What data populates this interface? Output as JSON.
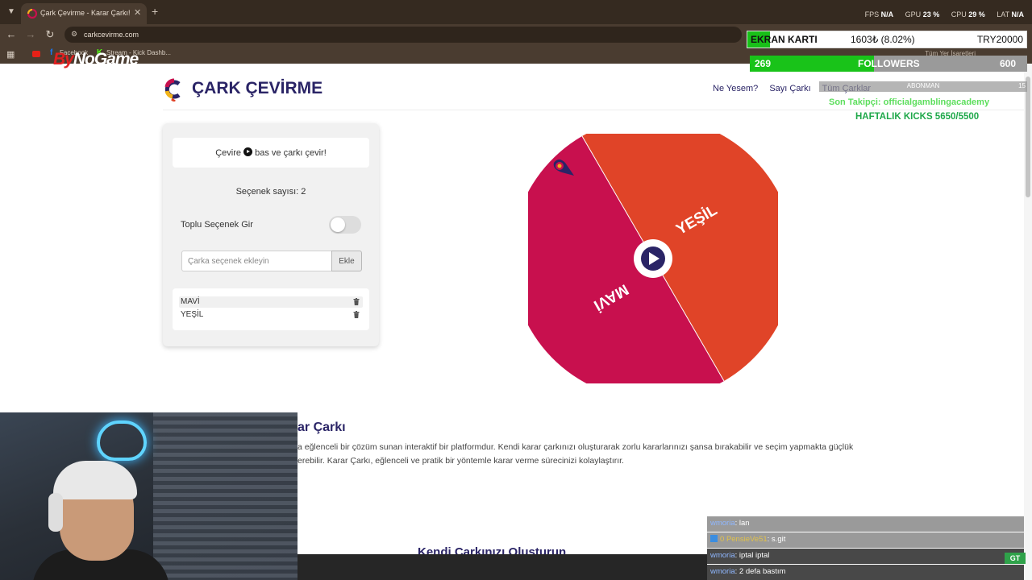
{
  "browser": {
    "tab_title": "Çark Çevirme - Karar Çarkı!",
    "url": "carkcevirme.com",
    "bookmarks": [
      "Facebook",
      "Stream - Kick Dashb..."
    ],
    "all_bookmarks": "Tüm Yer İşaretleri",
    "perf": {
      "fps_label": "FPS",
      "fps": "N/A",
      "gpu_label": "GPU",
      "gpu": "23 %",
      "cpu_label": "CPU",
      "cpu": "29 %",
      "lat_label": "LAT",
      "lat": "N/A"
    }
  },
  "overlay": {
    "brand": {
      "part1": "By",
      "part2": "NoGame"
    },
    "gpu": {
      "label": "EKRAN KARTI",
      "price": "1603₺ (8.02%)",
      "target": "TRY20000",
      "progress_percent": 8.02
    },
    "followers": {
      "count": "269",
      "label": "FOLLOWERS",
      "goal": "600",
      "progress_fraction": 0.448
    },
    "subs": {
      "label": "ABONMAN",
      "count": "15"
    },
    "last_follower": "Son Takipçi: officialgamblingacademy",
    "weekly_kicks": "HAFTALIK KICKS 5650/5500",
    "chat": [
      {
        "user": "wmoria",
        "text": ": lan"
      },
      {
        "badge": "0",
        "user": "PensieVe51",
        "text": ": s.git"
      },
      {
        "user": "wmoria",
        "text": ": iptal iptal"
      },
      {
        "user": "wmoria",
        "text": ": 2 defa bastım"
      }
    ],
    "badge": "GT"
  },
  "site": {
    "title": "ÇARK ÇEVİRME",
    "nav": [
      "Ne Yesem?",
      "Sayı Çarkı",
      "Tüm Çarklar"
    ],
    "panel": {
      "hint_pre": "Çevire",
      "hint_post": "bas ve çarkı çevir!",
      "option_count": "Seçenek sayısı: 2",
      "bulk_label": "Toplu Seçenek Gir",
      "input_placeholder": "Çarka seçenek ekleyin",
      "add_label": "Ekle",
      "options": [
        "MAVİ",
        "YEŞİL"
      ]
    },
    "wheel": {
      "segments": [
        {
          "label": "YEŞİL",
          "color": "#e04428"
        },
        {
          "label": "MAVİ",
          "color": "#c8104e"
        }
      ]
    },
    "about": {
      "title": "ar Çarkı",
      "line1": "a eğlenceli bir çözüm sunan interaktif bir platformdur. Kendi karar çarkınızı oluşturarak zorlu kararlarınızı şansa bırakabilir ve seçim yapmakta güçlük",
      "line2": "erebilir. Karar Çarkı, eğlenceli ve pratik bir yöntemle karar verme sürecinizi kolaylaştırır."
    },
    "create_title": "Kendi Çarkınızı Oluşturun"
  },
  "colors": {
    "brand": "#2a2466",
    "accent_green": "#19c319",
    "segment_red": "#e04428",
    "segment_magenta": "#c8104e"
  }
}
